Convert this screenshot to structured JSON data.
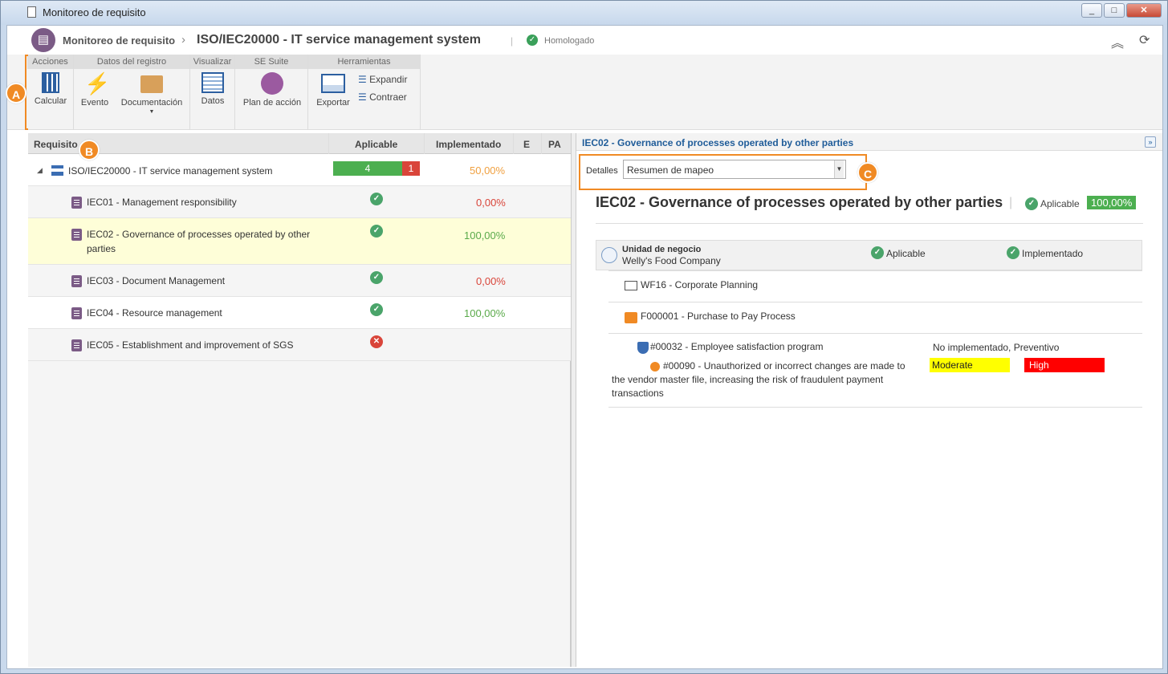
{
  "window": {
    "title": "Monitoreo de requisito",
    "controls": [
      "_",
      "□",
      "✕"
    ]
  },
  "header": {
    "crumb1": "Monitoreo de requisito",
    "crumb2": "ISO/IEC20000 - IT service management system",
    "status": "Homologado"
  },
  "ribbon": {
    "groups": [
      "Acciones",
      "Datos del registro",
      "Visualizar",
      "SE Suite",
      "Herramientas"
    ],
    "calcular": "Calcular",
    "evento": "Evento",
    "documentacion": "Documentación",
    "datos": "Datos",
    "plan": "Plan de acción",
    "exportar": "Exportar",
    "expandir": "Expandir",
    "contraer": "Contraer"
  },
  "annotations": {
    "a": "A",
    "b": "B",
    "c": "C"
  },
  "grid": {
    "headers": {
      "req": "Requisito",
      "apl": "Aplicable",
      "impl": "Implementado",
      "e": "E",
      "pa": "PA"
    },
    "root": {
      "label": "ISO/IEC20000 - IT service management system",
      "ok": "4",
      "fail": "1",
      "impl": "50,00%"
    },
    "rows": [
      {
        "label": "IEC01 - Management responsibility",
        "impl": "0,00%"
      },
      {
        "label": "IEC02 - Governance of processes operated by other parties",
        "impl": "100,00%"
      },
      {
        "label": "IEC03 - Document Management",
        "impl": "0,00%"
      },
      {
        "label": "IEC04 - Resource management",
        "impl": "100,00%"
      },
      {
        "label": "IEC05 - Establishment and improvement of SGS",
        "impl": ""
      }
    ]
  },
  "detail": {
    "panel_title": "IEC02 - Governance of processes operated by other parties",
    "details_label": "Detalles",
    "details_value": "Resumen de mapeo",
    "title": "IEC02 - Governance of processes operated by other parties",
    "applicable": "Aplicable",
    "pct": "100,00%",
    "bu_label": "Unidad de negocio",
    "bu_value": "Welly's Food Company",
    "col_apl": "Aplicable",
    "col_impl": "Implementado",
    "wf": "WF16 - Corporate Planning",
    "process": "F000001 - Purchase to Pay Process",
    "program": "#00032 - Employee satisfaction program",
    "program_status": "No implementado, Preventivo",
    "risk": "#00090 - Unauthorized or incorrect changes are made to the vendor master file, increasing the risk of fraudulent payment transactions",
    "risk_level1": "Moderate",
    "risk_level2": "High"
  },
  "colors": {
    "accent": "#f08a24",
    "ok": "#4aa46a",
    "fail": "#d9453a",
    "purple": "#7b5b86"
  }
}
